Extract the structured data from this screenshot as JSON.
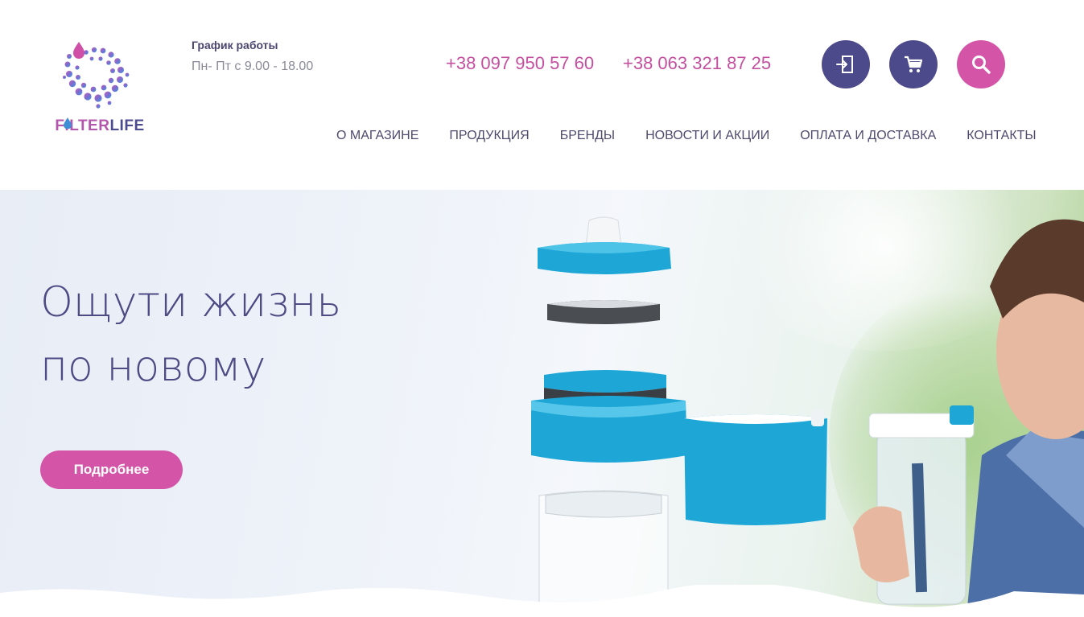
{
  "brand": {
    "logo_word1": "FILTER",
    "logo_word2": "LIFE",
    "colors": {
      "purple": "#4d4a8c",
      "pink": "#d455a8",
      "phone": "#c44f9f"
    }
  },
  "schedule": {
    "title": "График работы",
    "hours": "Пн- Пт с 9.00 - 18.00"
  },
  "phones": [
    "+38 097 950 57 60",
    "+38 063 321 87 25"
  ],
  "actions": {
    "login_icon": "login-icon",
    "cart_icon": "cart-icon",
    "search_icon": "search-icon"
  },
  "nav": [
    {
      "label": "О МАГАЗИНЕ"
    },
    {
      "label": "ПРОДУКЦИЯ"
    },
    {
      "label": "БРЕНДЫ"
    },
    {
      "label": "НОВОСТИ И АКЦИИ"
    },
    {
      "label": "ОПЛАТА И ДОСТАВКА"
    },
    {
      "label": "КОНТАКТЫ"
    }
  ],
  "hero": {
    "title_line1": "Ощути жизнь",
    "title_line2": "по новому",
    "button_label": "Подробнее"
  }
}
